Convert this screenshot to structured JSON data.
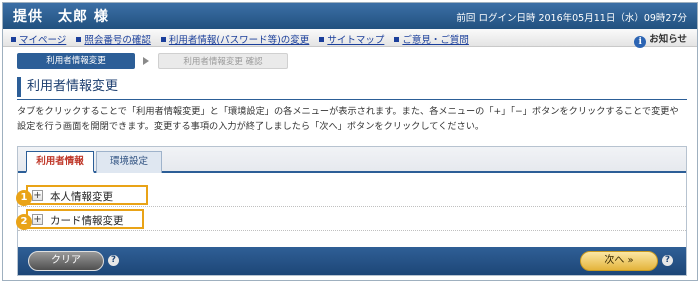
{
  "header": {
    "user_name": "提供　太郎 様",
    "last_login": "前回 ログイン日時 2016年05月11日（水）09時27分"
  },
  "nav": {
    "links": [
      "マイページ",
      "照会番号の確認",
      "利用者情報(パスワード等)の変更",
      "サイトマップ",
      "ご意見・ご質問"
    ],
    "notice_label": "お知らせ",
    "notice_icon": "info-icon"
  },
  "steps": {
    "current": "利用者情報変更",
    "next": "利用者情報変更 確認"
  },
  "page_title": "利用者情報変更",
  "description": "タブをクリックすることで「利用者情報変更」と「環境設定」の各メニューが表示されます。また、各メニューの「+」「−」ボタンをクリックすることで変更や設定を行う画面を開閉できます。変更する事項の入力が終了しましたら「次へ」ボタンをクリックしてください。",
  "tabs": [
    "利用者情報",
    "環境設定"
  ],
  "items": [
    {
      "number": "1",
      "label": "本人情報変更"
    },
    {
      "number": "2",
      "label": "カード情報変更"
    }
  ],
  "footer": {
    "clear_label": "クリア",
    "next_label": "次へ »",
    "help_mark": "?"
  },
  "colors": {
    "header_bg": "#2c5e97",
    "highlight": "#e9a317",
    "link": "#1b3f9b"
  }
}
